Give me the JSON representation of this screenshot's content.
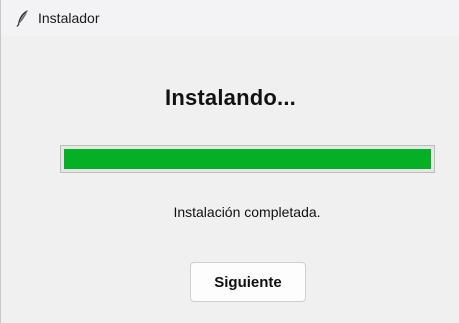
{
  "window": {
    "title": "Instalador",
    "icon": "feather-icon"
  },
  "main": {
    "heading": "Instalando...",
    "progress_percent": 100,
    "progress_color": "#06b025",
    "status_text": "Instalación completada.",
    "next_button_label": "Siguiente"
  }
}
